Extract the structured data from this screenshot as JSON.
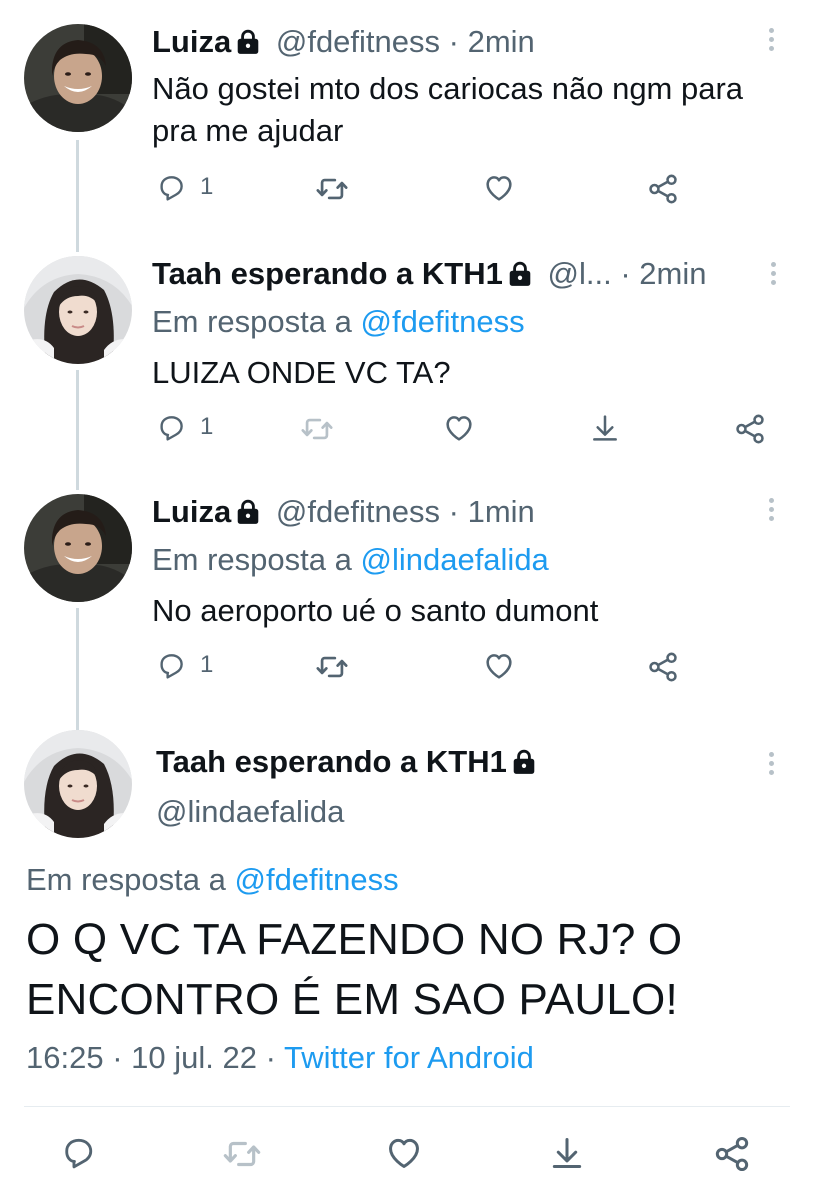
{
  "tweets": [
    {
      "name": "Luiza",
      "handle": "@fdefitness",
      "separator": "·",
      "time": "2min",
      "reply_prefix": "",
      "reply_to": "",
      "text": "Não gostei mto dos cariocas não ngm para pra me ajudar",
      "reply_count": "1"
    },
    {
      "name": "Taah esperando a KTH1",
      "handle": "@l...",
      "separator": "·",
      "time": "2min",
      "reply_prefix": "Em resposta a ",
      "reply_to": "@fdefitness",
      "text": "LUIZA ONDE VC TA?",
      "reply_count": "1"
    },
    {
      "name": "Luiza",
      "handle": "@fdefitness",
      "separator": "·",
      "time": "1min",
      "reply_prefix": "Em resposta a ",
      "reply_to": "@lindaefalida",
      "text": "No aeroporto ué o santo dumont",
      "reply_count": "1"
    }
  ],
  "main_tweet": {
    "name": "Taah esperando a KTH1",
    "handle": "@lindaefalida",
    "reply_prefix": "Em resposta a ",
    "reply_to": "@fdefitness",
    "text": "O Q VC TA FAZENDO NO RJ? O ENCONTRO É EM SAO PAULO!",
    "time": "16:25",
    "date": "10 jul. 22",
    "separator": "·",
    "source": "Twitter for Android"
  },
  "colors": {
    "text": "#0f1419",
    "secondary": "#536471",
    "link": "#1d9bf0",
    "thread_line": "#cfd9de",
    "icon_faded": "#b7c1c8"
  },
  "icons": [
    "reply-icon",
    "retweet-icon",
    "like-icon",
    "download-icon",
    "share-icon",
    "lock-icon",
    "more-icon"
  ]
}
